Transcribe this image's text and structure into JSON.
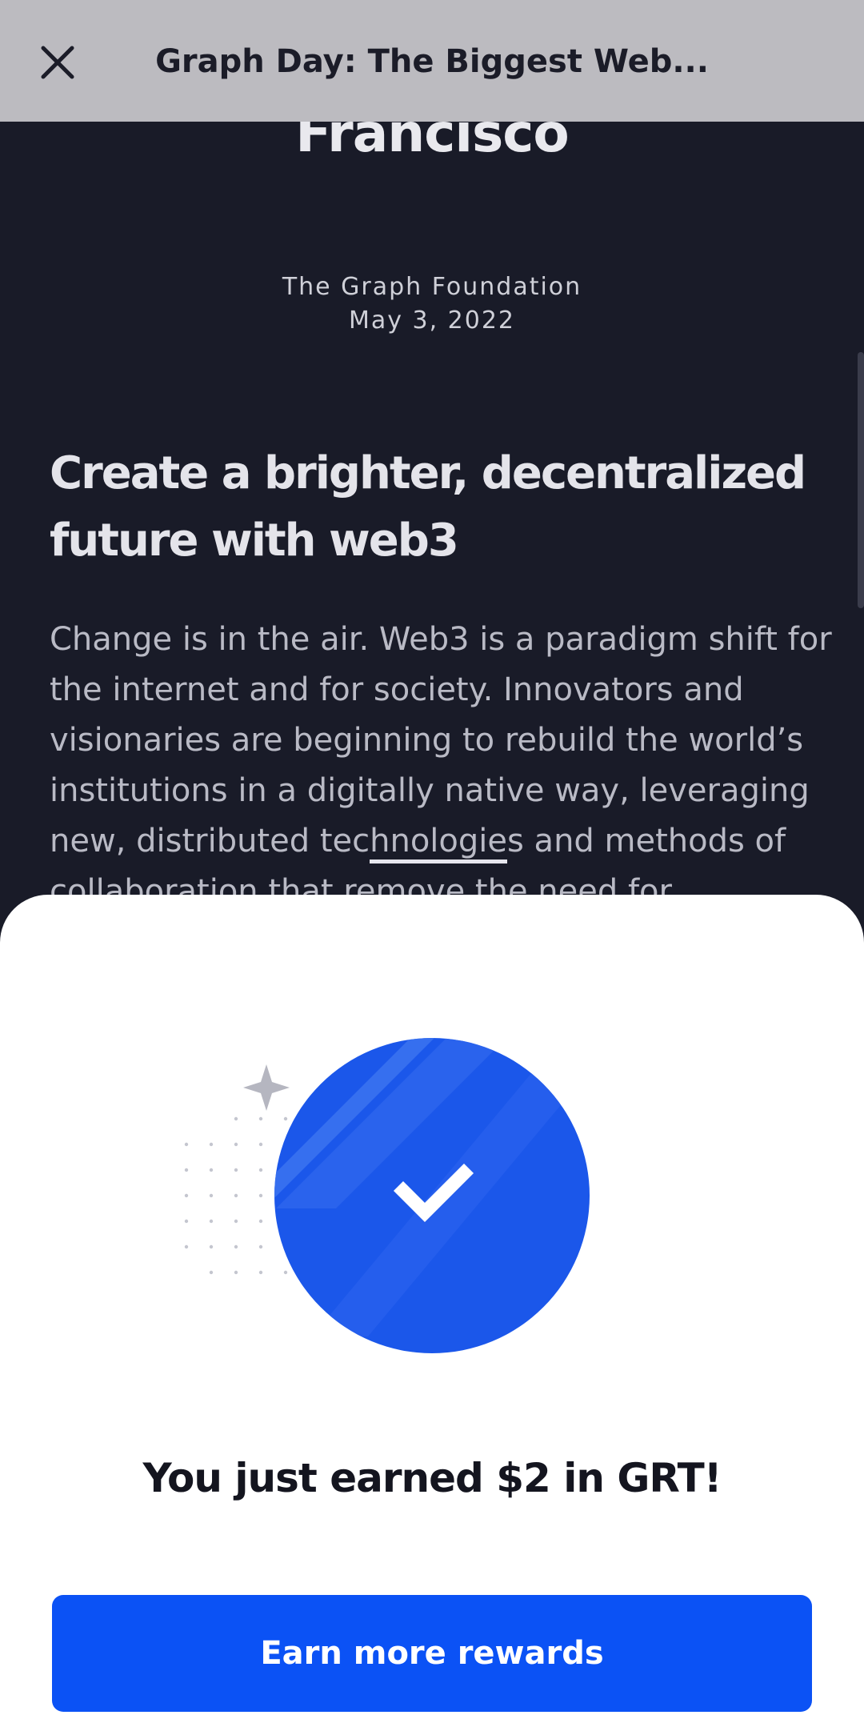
{
  "header": {
    "title": "Graph Day: The Biggest Web...",
    "close_icon": "close-icon"
  },
  "article": {
    "title_tail": "Francisco",
    "author": "The Graph Foundation",
    "date": "May 3, 2022",
    "section_heading": "Create a brighter, decentralized future with web3",
    "body_before_link": "Change is in the air. Web3 is a paradigm shift for the internet and for society. Innovators and visionaries are beginning to rebuild the world’s institutions in a digitally native way, leveraging new, distributed tec",
    "body_link": "hnologie",
    "body_after_link": "s and methods of collaboration that remove the need for"
  },
  "reward_sheet": {
    "illustration_icon": "checkmark-coin-icon",
    "message": "You just earned $2 in GRT!",
    "cta_label": "Earn more rewards"
  },
  "colors": {
    "accent": "#0b52f5",
    "article_background": "#191b28",
    "top_bar": "#bcbbc0"
  }
}
